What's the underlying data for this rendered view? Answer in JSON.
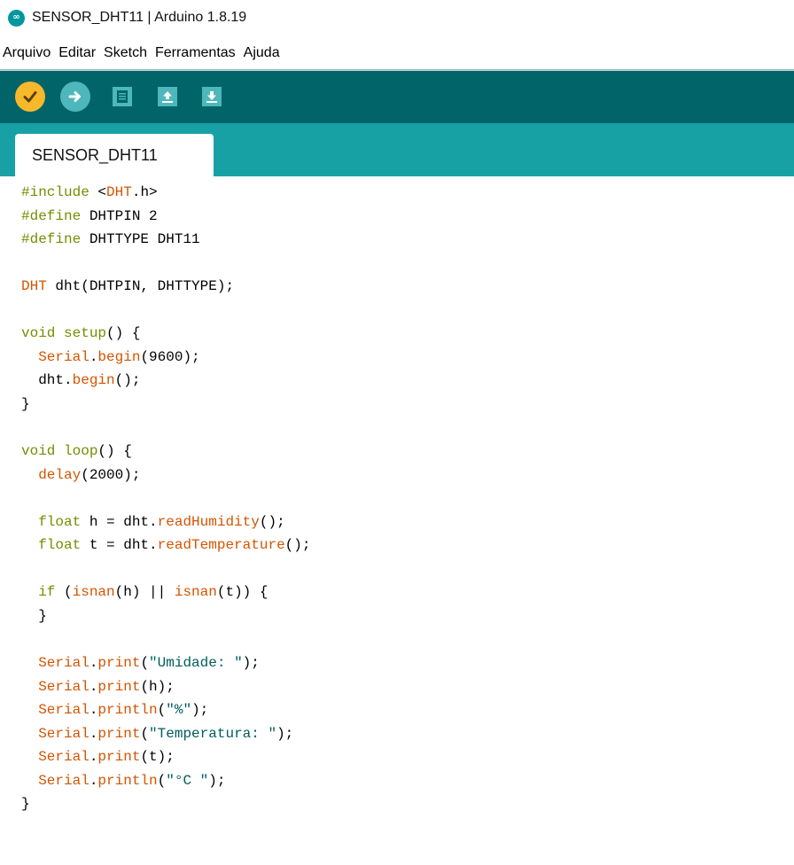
{
  "window": {
    "title": "SENSOR_DHT11 | Arduino 1.8.19",
    "logo_glyph": "∞"
  },
  "menu": {
    "items": [
      "Arquivo",
      "Editar",
      "Sketch",
      "Ferramentas",
      "Ajuda"
    ]
  },
  "toolbar": {
    "buttons": [
      {
        "name": "verify-button",
        "icon": "check-icon",
        "color": "#f8b82c"
      },
      {
        "name": "upload-button",
        "icon": "arrow-right-icon",
        "color": "#4db7bb"
      },
      {
        "name": "new-button",
        "icon": "document-icon",
        "color": "#4db7bb"
      },
      {
        "name": "open-button",
        "icon": "arrow-up-icon",
        "color": "#4db7bb"
      },
      {
        "name": "save-button",
        "icon": "arrow-down-icon",
        "color": "#4db7bb"
      }
    ],
    "background": "#006468"
  },
  "tabs": [
    {
      "label": "SENSOR_DHT11"
    }
  ],
  "colors": {
    "keyword": "#728e00",
    "class_function": "#d35400",
    "string": "#005c5f",
    "tabstrip": "#17a1a5"
  },
  "editor": {
    "lines": [
      [
        [
          "kw",
          "#include"
        ],
        [
          "t",
          " "
        ],
        [
          "t",
          "<"
        ],
        [
          "cls",
          "DHT"
        ],
        [
          "t",
          ".h>"
        ]
      ],
      [
        [
          "kw",
          "#define"
        ],
        [
          "t",
          " DHTPIN 2"
        ]
      ],
      [
        [
          "kw",
          "#define"
        ],
        [
          "t",
          " DHTTYPE DHT11"
        ]
      ],
      [],
      [
        [
          "cls",
          "DHT"
        ],
        [
          "t",
          " dht(DHTPIN, DHTTYPE);"
        ]
      ],
      [],
      [
        [
          "kw",
          "void"
        ],
        [
          "t",
          " "
        ],
        [
          "kw",
          "setup"
        ],
        [
          "t",
          "() {"
        ]
      ],
      [
        [
          "t",
          "  "
        ],
        [
          "cls",
          "Serial"
        ],
        [
          "t",
          "."
        ],
        [
          "cls",
          "begin"
        ],
        [
          "t",
          "(9600);"
        ]
      ],
      [
        [
          "t",
          "  dht."
        ],
        [
          "cls",
          "begin"
        ],
        [
          "t",
          "();"
        ]
      ],
      [
        [
          "t",
          "}"
        ]
      ],
      [],
      [
        [
          "kw",
          "void"
        ],
        [
          "t",
          " "
        ],
        [
          "kw",
          "loop"
        ],
        [
          "t",
          "() {"
        ]
      ],
      [
        [
          "t",
          "  "
        ],
        [
          "cls",
          "delay"
        ],
        [
          "t",
          "(2000);"
        ]
      ],
      [],
      [
        [
          "t",
          "  "
        ],
        [
          "kw",
          "float"
        ],
        [
          "t",
          " h = dht."
        ],
        [
          "cls",
          "readHumidity"
        ],
        [
          "t",
          "();"
        ]
      ],
      [
        [
          "t",
          "  "
        ],
        [
          "kw",
          "float"
        ],
        [
          "t",
          " t = dht."
        ],
        [
          "cls",
          "readTemperature"
        ],
        [
          "t",
          "();"
        ]
      ],
      [],
      [
        [
          "t",
          "  "
        ],
        [
          "kw",
          "if"
        ],
        [
          "t",
          " ("
        ],
        [
          "cls",
          "isnan"
        ],
        [
          "t",
          "(h) || "
        ],
        [
          "cls",
          "isnan"
        ],
        [
          "t",
          "(t)) {"
        ]
      ],
      [
        [
          "t",
          "  }"
        ]
      ],
      [],
      [
        [
          "t",
          "  "
        ],
        [
          "cls",
          "Serial"
        ],
        [
          "t",
          "."
        ],
        [
          "cls",
          "print"
        ],
        [
          "t",
          "("
        ],
        [
          "str",
          "\"Umidade: \""
        ],
        [
          "t",
          ");"
        ]
      ],
      [
        [
          "t",
          "  "
        ],
        [
          "cls",
          "Serial"
        ],
        [
          "t",
          "."
        ],
        [
          "cls",
          "print"
        ],
        [
          "t",
          "(h);"
        ]
      ],
      [
        [
          "t",
          "  "
        ],
        [
          "cls",
          "Serial"
        ],
        [
          "t",
          "."
        ],
        [
          "cls",
          "println"
        ],
        [
          "t",
          "("
        ],
        [
          "str",
          "\"%\""
        ],
        [
          "t",
          ");"
        ]
      ],
      [
        [
          "t",
          "  "
        ],
        [
          "cls",
          "Serial"
        ],
        [
          "t",
          "."
        ],
        [
          "cls",
          "print"
        ],
        [
          "t",
          "("
        ],
        [
          "str",
          "\"Temperatura: \""
        ],
        [
          "t",
          ");"
        ]
      ],
      [
        [
          "t",
          "  "
        ],
        [
          "cls",
          "Serial"
        ],
        [
          "t",
          "."
        ],
        [
          "cls",
          "print"
        ],
        [
          "t",
          "(t);"
        ]
      ],
      [
        [
          "t",
          "  "
        ],
        [
          "cls",
          "Serial"
        ],
        [
          "t",
          "."
        ],
        [
          "cls",
          "println"
        ],
        [
          "t",
          "("
        ],
        [
          "str",
          "\"°C \""
        ],
        [
          "t",
          ");"
        ]
      ],
      [
        [
          "t",
          "}"
        ]
      ]
    ]
  }
}
